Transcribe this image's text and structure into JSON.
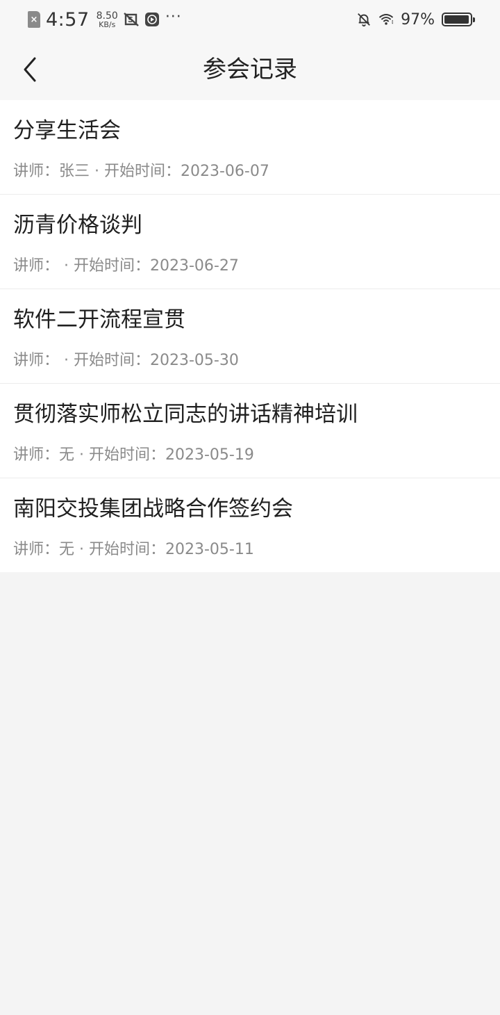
{
  "status_bar": {
    "time": "4:57",
    "net_speed_value": "8.50",
    "net_speed_unit": "KB/s",
    "sim_label": "×",
    "more": "···",
    "battery_percent": "97%",
    "battery_level": 0.97
  },
  "nav": {
    "title": "参会记录",
    "back_icon": "chevron-left-icon"
  },
  "records": [
    {
      "title": "分享生活会",
      "meta": "讲师：张三 · 开始时间：2023-06-07"
    },
    {
      "title": "沥青价格谈判",
      "meta": "讲师： · 开始时间：2023-06-27"
    },
    {
      "title": "软件二开流程宣贯",
      "meta": "讲师： · 开始时间：2023-05-30"
    },
    {
      "title": "贯彻落实师松立同志的讲话精神培训",
      "meta": "讲师：无 · 开始时间：2023-05-19"
    },
    {
      "title": "南阳交投集团战略合作签约会",
      "meta": "讲师：无 · 开始时间：2023-05-11"
    }
  ],
  "colors": {
    "page_background": "#f4f4f4",
    "header_background": "#f7f7f7",
    "title_text": "#1f1f1f",
    "meta_text": "#8a8a8a"
  }
}
